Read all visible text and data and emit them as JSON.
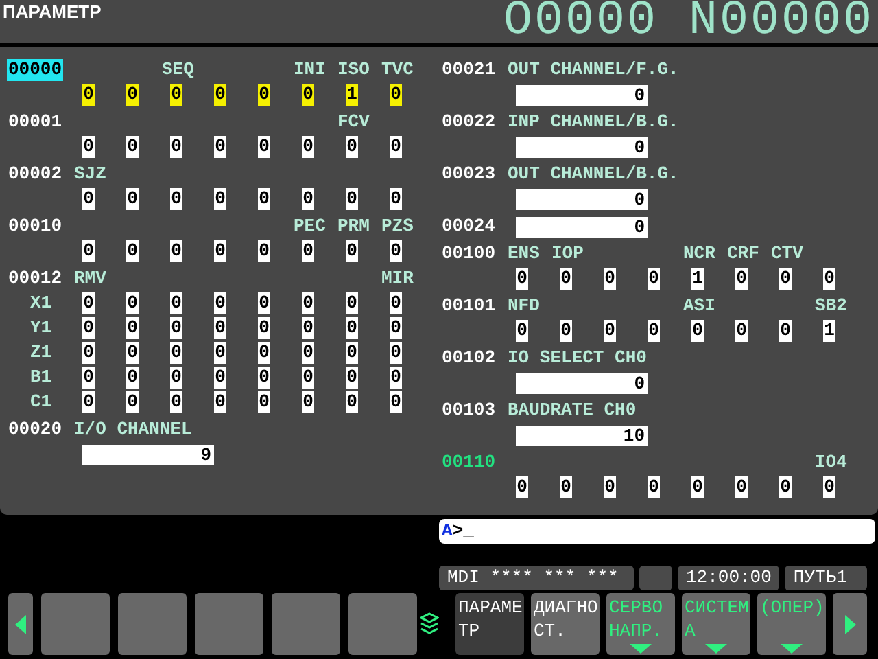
{
  "title": "ПАРАМЕТР",
  "program": "O0000 N00000",
  "columns": [
    [
      {
        "kind": "bits",
        "number": "00000",
        "selected": true,
        "flagged": false,
        "labels": {
          "bit5": "SEQ",
          "bit2": "INI",
          "bit1": "ISO",
          "bit0": "TVC"
        },
        "rows": [
          {
            "bits": [
              "0",
              "0",
              "0",
              "0",
              "0",
              "0",
              "1",
              "0"
            ]
          }
        ]
      },
      {
        "kind": "bits",
        "number": "00001",
        "selected": false,
        "flagged": false,
        "labels": {
          "bit1": "FCV"
        },
        "rows": [
          {
            "bits": [
              "0",
              "0",
              "0",
              "0",
              "0",
              "0",
              "0",
              "0"
            ]
          }
        ]
      },
      {
        "kind": "bits",
        "number": "00002",
        "selected": false,
        "flagged": false,
        "labels": {
          "bit7": "SJZ"
        },
        "rows": [
          {
            "bits": [
              "0",
              "0",
              "0",
              "0",
              "0",
              "0",
              "0",
              "0"
            ]
          }
        ]
      },
      {
        "kind": "bits",
        "number": "00010",
        "selected": false,
        "flagged": false,
        "labels": {
          "bit2": "PEC",
          "bit1": "PRM",
          "bit0": "PZS"
        },
        "rows": [
          {
            "bits": [
              "0",
              "0",
              "0",
              "0",
              "0",
              "0",
              "0",
              "0"
            ]
          }
        ]
      },
      {
        "kind": "bits",
        "number": "00012",
        "selected": false,
        "flagged": false,
        "labels": {
          "bit7": "RMV",
          "bit0": "MIR"
        },
        "rows": [
          {
            "axis": "X1",
            "bits": [
              "0",
              "0",
              "0",
              "0",
              "0",
              "0",
              "0",
              "0"
            ]
          },
          {
            "axis": "Y1",
            "bits": [
              "0",
              "0",
              "0",
              "0",
              "0",
              "0",
              "0",
              "0"
            ]
          },
          {
            "axis": "Z1",
            "bits": [
              "0",
              "0",
              "0",
              "0",
              "0",
              "0",
              "0",
              "0"
            ]
          },
          {
            "axis": "B1",
            "bits": [
              "0",
              "0",
              "0",
              "0",
              "0",
              "0",
              "0",
              "0"
            ]
          },
          {
            "axis": "C1",
            "bits": [
              "0",
              "0",
              "0",
              "0",
              "0",
              "0",
              "0",
              "0"
            ]
          }
        ]
      },
      {
        "kind": "value",
        "number": "00020",
        "selected": false,
        "flagged": false,
        "label": "I/O CHANNEL",
        "value": "9"
      }
    ],
    [
      {
        "kind": "value",
        "number": "00021",
        "selected": false,
        "flagged": false,
        "label": "OUT CHANNEL/F.G.",
        "value": "0"
      },
      {
        "kind": "value",
        "number": "00022",
        "selected": false,
        "flagged": false,
        "label": "INP CHANNEL/B.G.",
        "value": "0"
      },
      {
        "kind": "value",
        "number": "00023",
        "selected": false,
        "flagged": false,
        "label": "OUT CHANNEL/B.G.",
        "value": "0"
      },
      {
        "kind": "value",
        "number": "00024",
        "selected": false,
        "flagged": false,
        "value": "0"
      },
      {
        "kind": "bits",
        "number": "00100",
        "selected": false,
        "flagged": false,
        "labels": {
          "bit7": "ENS",
          "bit6": "IOP",
          "bit3": "NCR",
          "bit2": "CRF",
          "bit1": "CTV"
        },
        "rows": [
          {
            "bits": [
              "0",
              "0",
              "0",
              "0",
              "1",
              "0",
              "0",
              "0"
            ]
          }
        ]
      },
      {
        "kind": "bits",
        "number": "00101",
        "selected": false,
        "flagged": false,
        "labels": {
          "bit7": "NFD",
          "bit3": "ASI",
          "bit0": "SB2"
        },
        "rows": [
          {
            "bits": [
              "0",
              "0",
              "0",
              "0",
              "0",
              "0",
              "0",
              "1"
            ]
          }
        ]
      },
      {
        "kind": "value",
        "number": "00102",
        "selected": false,
        "flagged": false,
        "label": "IO SELECT CH0",
        "value": "0"
      },
      {
        "kind": "value",
        "number": "00103",
        "selected": false,
        "flagged": false,
        "label": "BAUDRATE CH0",
        "value": "10"
      },
      {
        "kind": "bits",
        "number": "00110",
        "selected": false,
        "flagged": true,
        "labels": {
          "bit0": "IO4"
        },
        "rows": [
          {
            "bits": [
              "0",
              "0",
              "0",
              "0",
              "0",
              "0",
              "0",
              "0"
            ]
          }
        ]
      }
    ]
  ],
  "input": {
    "axis": "A",
    "text": ">_"
  },
  "status": {
    "mode": "MDI **** *** ***",
    "time": "12:00:00",
    "path": "ПУТЬ1"
  },
  "softkeys": [
    {
      "kind": "blank",
      "selected": false,
      "submenu": false
    },
    {
      "kind": "blank",
      "selected": false,
      "submenu": false
    },
    {
      "kind": "blank",
      "selected": false,
      "submenu": false
    },
    {
      "kind": "blank",
      "selected": false,
      "submenu": false
    },
    {
      "kind": "blank",
      "selected": false,
      "submenu": false
    },
    {
      "kind": "label",
      "lines": [
        "ПАРАМЕ",
        "ТР"
      ],
      "selected": true,
      "submenu": false
    },
    {
      "kind": "label",
      "lines": [
        "ДИАГНО",
        "СТ."
      ],
      "selected": false,
      "submenu": false
    },
    {
      "kind": "label",
      "lines": [
        "СЕРВО",
        "НАПР."
      ],
      "selected": false,
      "submenu": true
    },
    {
      "kind": "label",
      "lines": [
        "СИСТЕМ",
        "А"
      ],
      "selected": false,
      "submenu": true
    },
    {
      "kind": "label",
      "lines": [
        "(ОПЕР)"
      ],
      "selected": false,
      "submenu": true
    }
  ]
}
